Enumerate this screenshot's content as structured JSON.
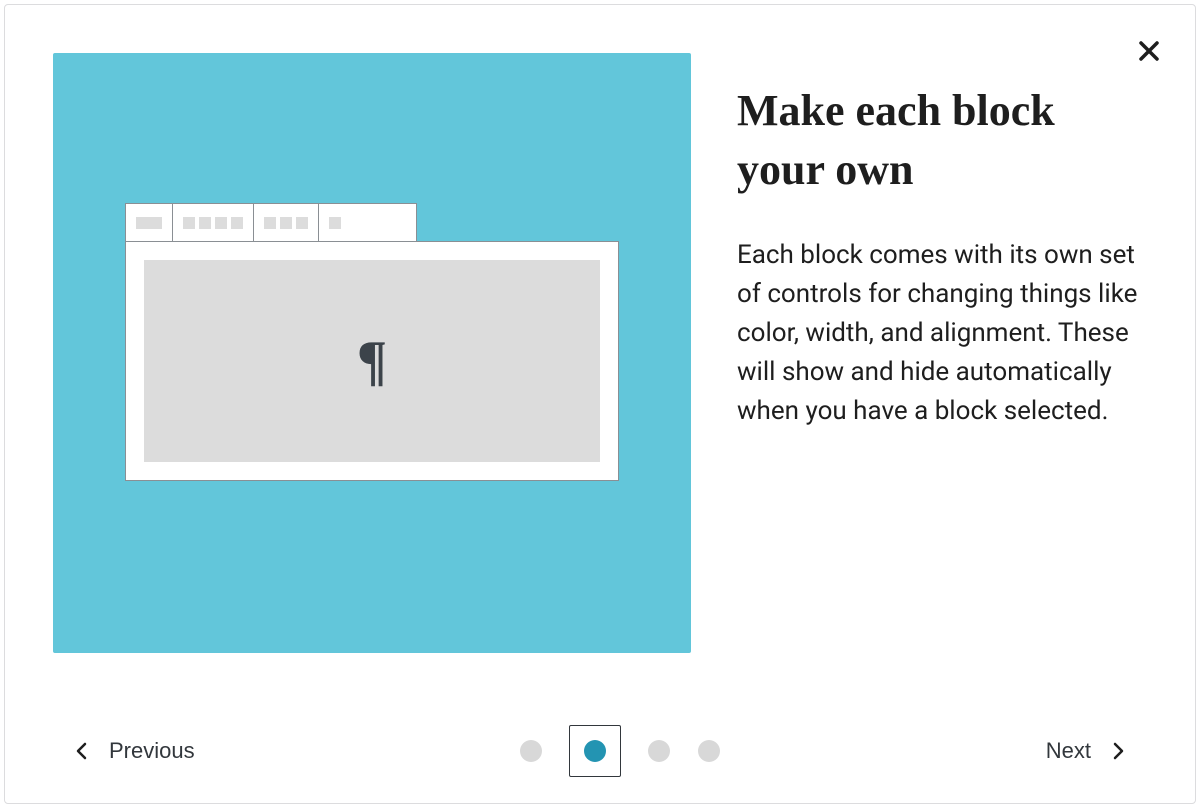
{
  "heading": "Make each block your own",
  "body_text": "Each block comes with its own set of controls for changing things like color, width, and alignment. These will show and hide automatically when you have a block selected.",
  "illustration_glyph": "¶",
  "nav": {
    "previous_label": "Previous",
    "next_label": "Next"
  },
  "page_count": 4,
  "active_page_index": 1
}
